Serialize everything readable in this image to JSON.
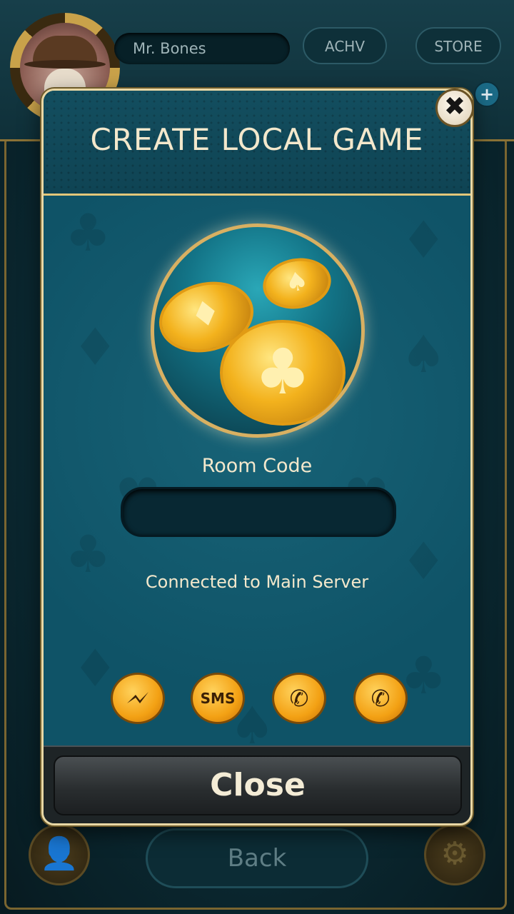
{
  "background": {
    "player_name": "Mr. Bones",
    "achv_label": "ACHV",
    "store_label": "STORE",
    "back_label": "Back"
  },
  "modal": {
    "title": "CREATE LOCAL GAME",
    "room_code_label": "Room Code",
    "room_code_value": "",
    "status_text": "Connected to Main Server",
    "share_buttons": [
      {
        "icon": "messenger-icon",
        "label": ""
      },
      {
        "icon": "sms-icon",
        "label": "SMS"
      },
      {
        "icon": "whatsapp-icon",
        "label": ""
      },
      {
        "icon": "viber-icon",
        "label": ""
      }
    ],
    "close_label": "Close",
    "dismiss_glyph": "✖"
  },
  "colors": {
    "accent_gold": "#e3c77a",
    "panel_teal": "#0f5367",
    "text_cream": "#f3e8cc"
  }
}
